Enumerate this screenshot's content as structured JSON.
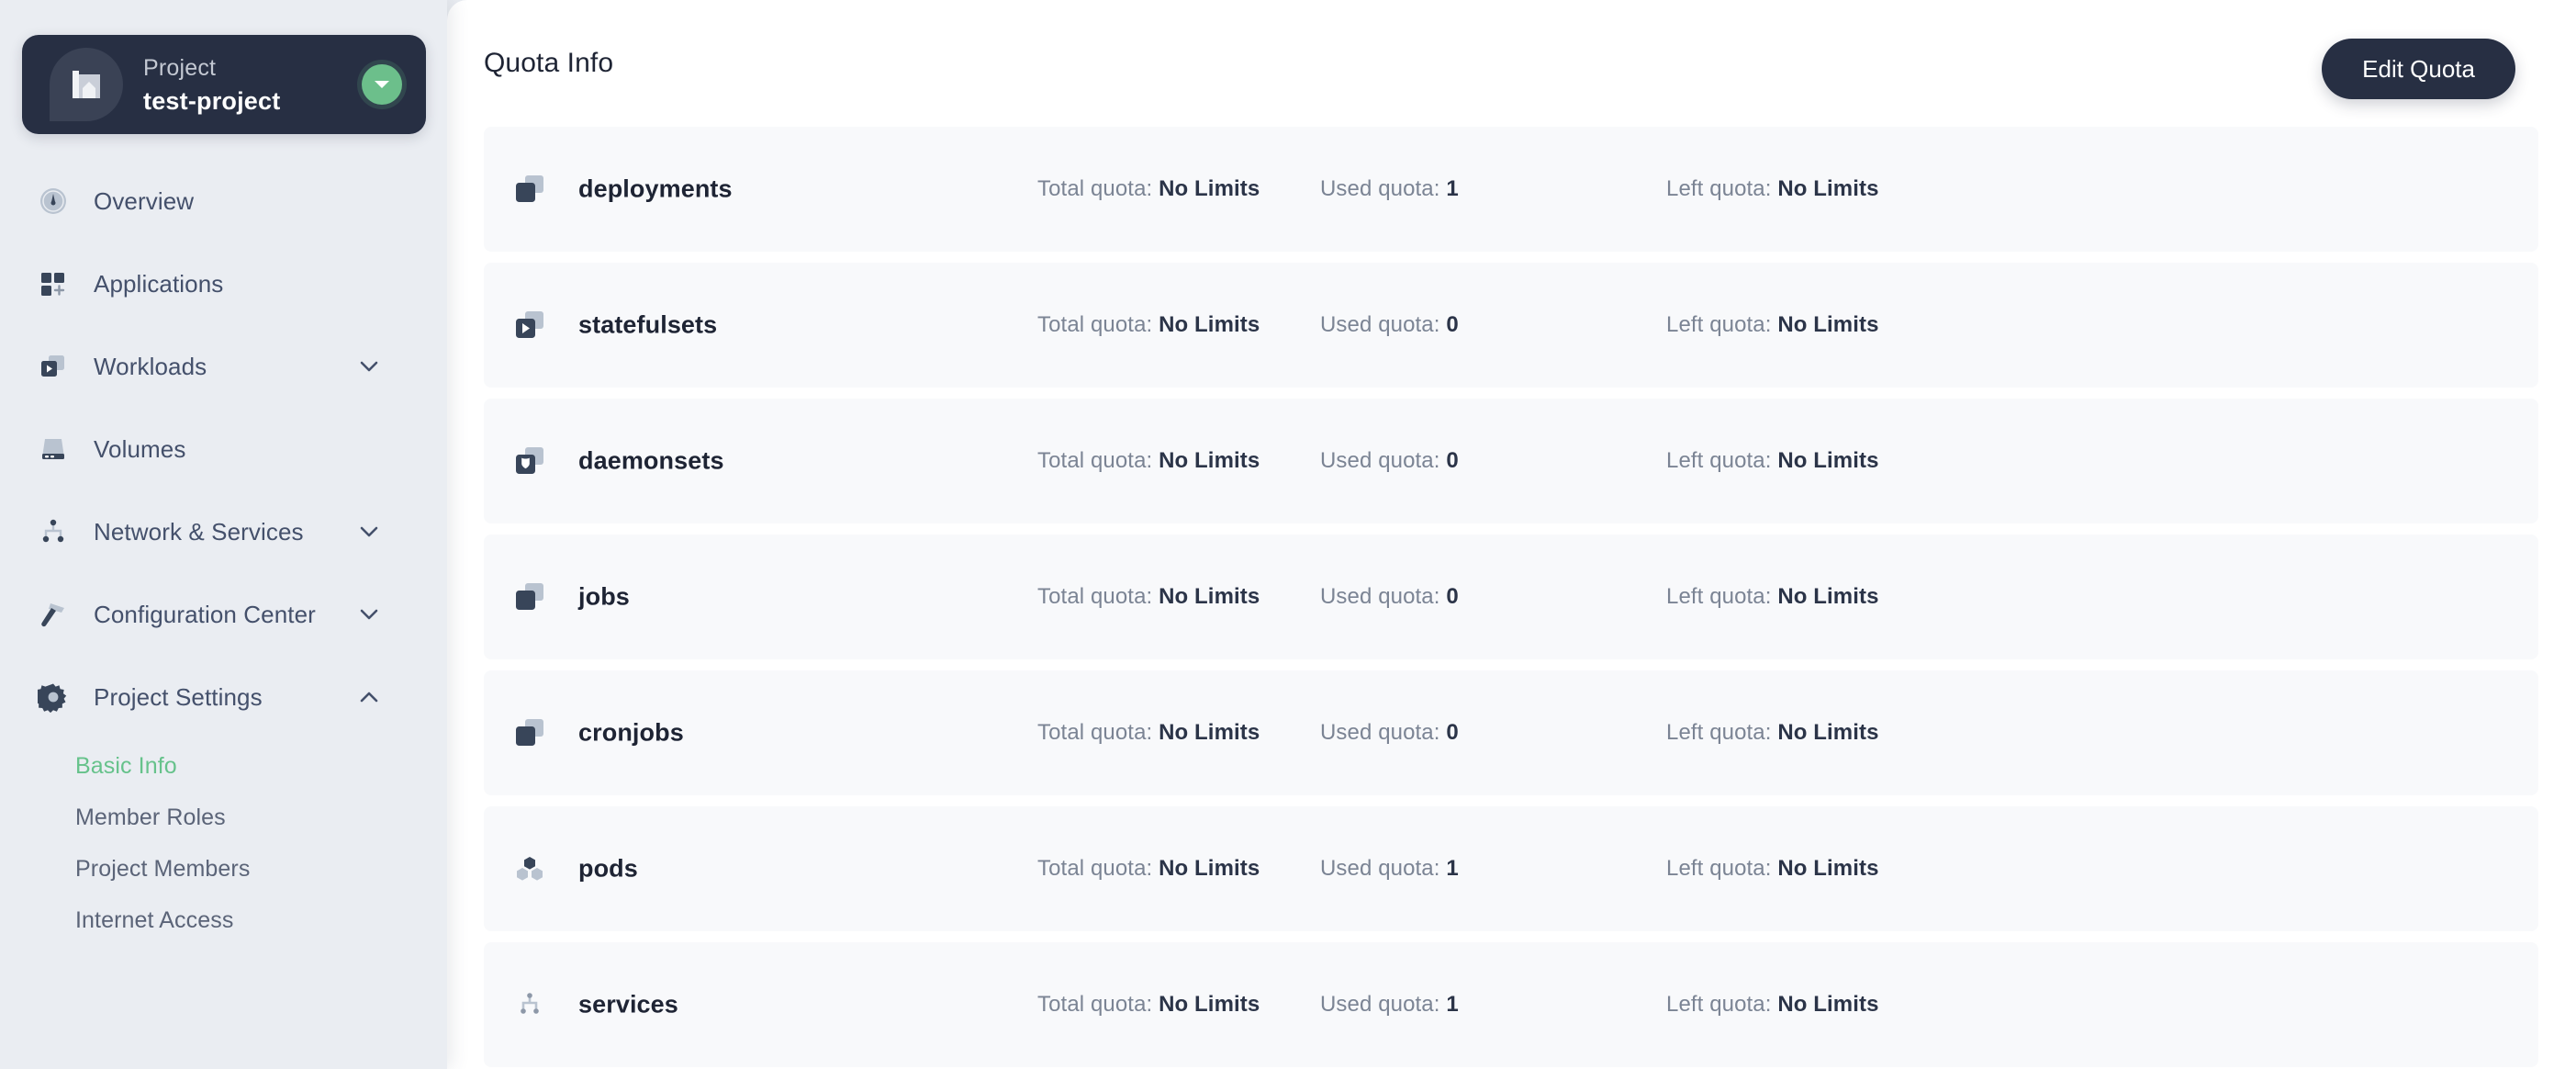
{
  "sidebar": {
    "project_card": {
      "label": "Project",
      "name": "test-project",
      "logo_icon": "project-blueprint-icon",
      "chevron_icon": "chevron-down-icon"
    },
    "items": [
      {
        "label": "Overview",
        "icon": "gauge-icon",
        "expandable": false
      },
      {
        "label": "Applications",
        "icon": "grid-apps-icon",
        "expandable": false
      },
      {
        "label": "Workloads",
        "icon": "workload-icon",
        "expandable": true,
        "expanded": false
      },
      {
        "label": "Volumes",
        "icon": "volume-icon",
        "expandable": false
      },
      {
        "label": "Network & Services",
        "icon": "network-icon",
        "expandable": true,
        "expanded": false
      },
      {
        "label": "Configuration Center",
        "icon": "hammer-icon",
        "expandable": true,
        "expanded": false
      },
      {
        "label": "Project Settings",
        "icon": "gear-icon",
        "expandable": true,
        "expanded": true
      }
    ],
    "subitems": [
      {
        "label": "Basic Info",
        "active": true
      },
      {
        "label": "Member Roles",
        "active": false
      },
      {
        "label": "Project Members",
        "active": false
      },
      {
        "label": "Internet Access",
        "active": false
      }
    ]
  },
  "header": {
    "title": "Quota Info",
    "edit_quota_label": "Edit Quota"
  },
  "quota": {
    "total_label": "Total quota:",
    "used_label": "Used quota:",
    "left_label": "Left quota:",
    "rows": [
      {
        "name": "deployments",
        "icon": "deployment-icon",
        "total": "No Limits",
        "used": "1",
        "left": "No Limits"
      },
      {
        "name": "statefulsets",
        "icon": "statefulset-icon",
        "total": "No Limits",
        "used": "0",
        "left": "No Limits"
      },
      {
        "name": "daemonsets",
        "icon": "daemonset-icon",
        "total": "No Limits",
        "used": "0",
        "left": "No Limits"
      },
      {
        "name": "jobs",
        "icon": "job-icon",
        "total": "No Limits",
        "used": "0",
        "left": "No Limits"
      },
      {
        "name": "cronjobs",
        "icon": "cronjob-icon",
        "total": "No Limits",
        "used": "0",
        "left": "No Limits"
      },
      {
        "name": "pods",
        "icon": "pod-icon",
        "total": "No Limits",
        "used": "1",
        "left": "No Limits"
      },
      {
        "name": "services",
        "icon": "service-icon",
        "total": "No Limits",
        "used": "1",
        "left": "No Limits"
      }
    ]
  },
  "colors": {
    "accent_green": "#66c28b",
    "dark_navy": "#272f43",
    "sidebar_bg": "#eaedf2",
    "row_bg": "#f8f9fb",
    "muted_text": "#7b8494"
  }
}
